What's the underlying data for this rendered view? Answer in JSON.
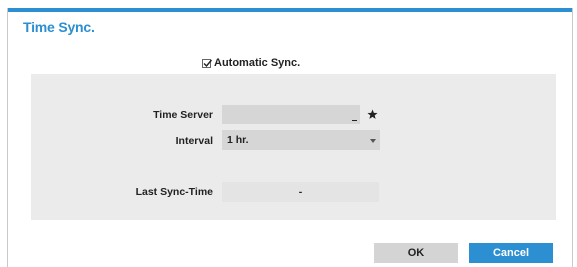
{
  "dialog": {
    "title": "Time Sync.",
    "accent_color": "#2b8fd1"
  },
  "automatic_sync": {
    "label": "Automatic Sync.",
    "checked": true
  },
  "form": {
    "time_server": {
      "label": "Time Server",
      "value": "",
      "icon": "star-icon"
    },
    "interval": {
      "label": "Interval",
      "value": "1 hr.",
      "icon": "chevron-down-icon"
    },
    "last_sync_time": {
      "label": "Last Sync-Time",
      "value": "-"
    }
  },
  "buttons": {
    "ok_label": "OK",
    "cancel_label": "Cancel"
  }
}
